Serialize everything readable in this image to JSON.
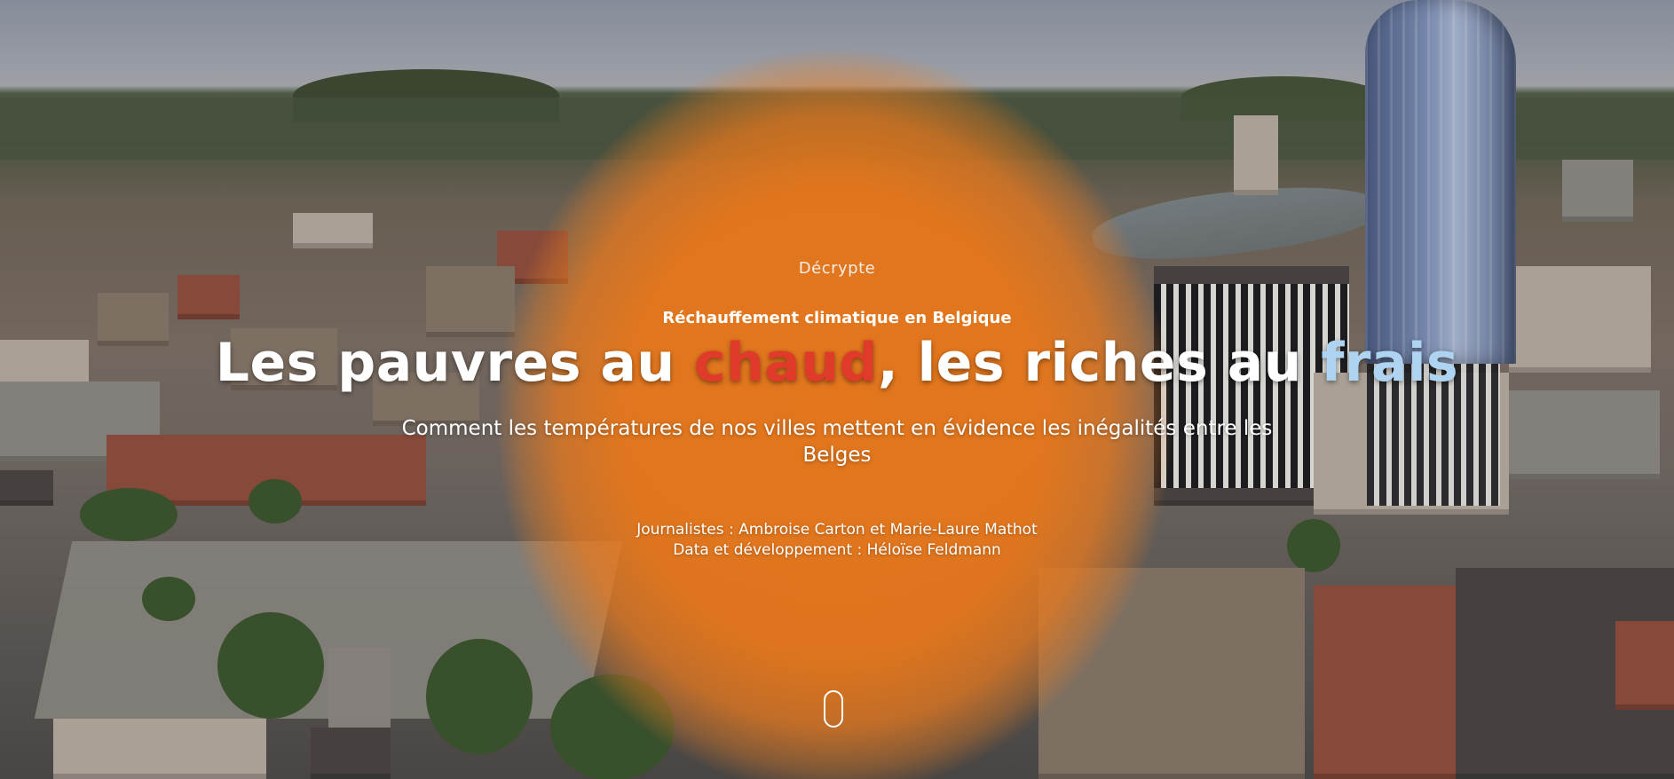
{
  "hero": {
    "category": "Décrypte",
    "kicker": "Réchauffement climatique en Belgique",
    "headline": {
      "part1": "Les pauvres au ",
      "hot_word": "chaud",
      "part2": ", les riches au ",
      "cool_word": "frais"
    },
    "dek": "Comment les températures de nos villes mettent en évidence les inégalités entre les Belges",
    "credits": {
      "journalists": "Journalistes : Ambroise Carton et Marie-Laure Mathot",
      "data_dev": "Data et développement : Héloïse Feldmann"
    }
  },
  "colors": {
    "hot_word": "#e03a2a",
    "cool_word": "#aed4f2",
    "glow": "#ec7818",
    "text": "#ffffff"
  },
  "icons": {
    "scroll": "mouse-scroll-icon"
  }
}
